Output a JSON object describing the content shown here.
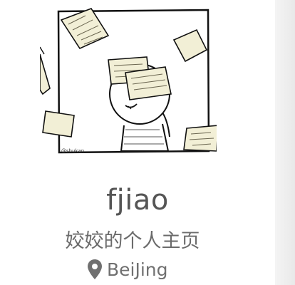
{
  "profile": {
    "name": "fjiao",
    "bio": "姣姣的个人主页",
    "location": "BeiJing",
    "location_icon": "map-marker-icon"
  },
  "avatar": {
    "description_icon": "avatar-illustration",
    "signature": "@shukan"
  },
  "colors": {
    "text_primary": "#555555",
    "text_secondary": "#6b6b6b",
    "paper": "#f2efd6",
    "sidebar_shade": "#ececec"
  }
}
